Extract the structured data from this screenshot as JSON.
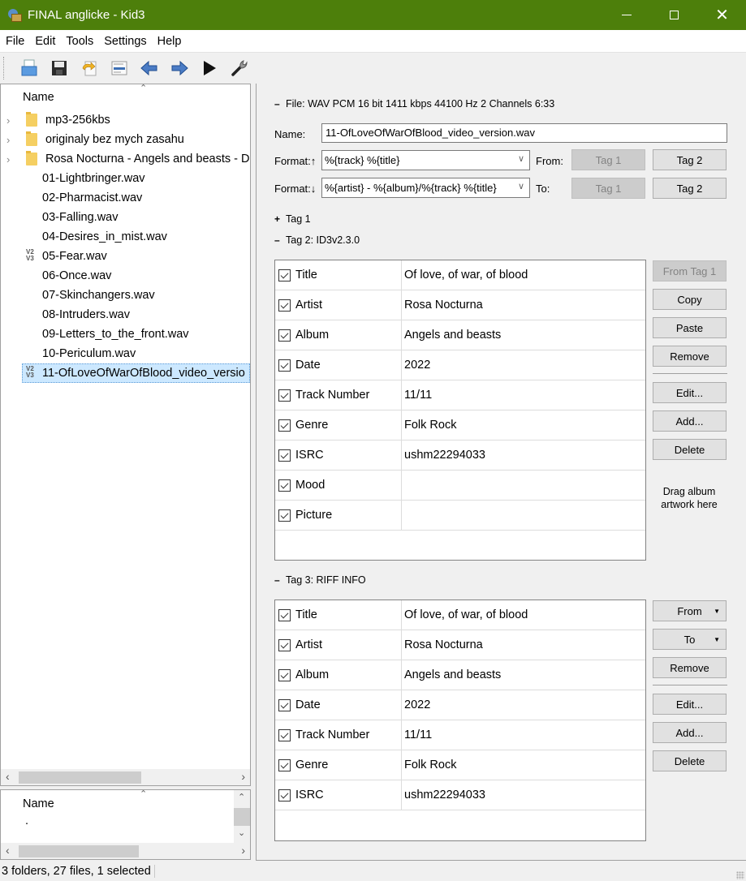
{
  "window": {
    "title": "FINAL anglicke - Kid3",
    "app_icon": "kid3-app-icon",
    "controls": [
      "minimize",
      "maximize",
      "close"
    ]
  },
  "menu": [
    "File",
    "Edit",
    "Tools",
    "Settings",
    "Help"
  ],
  "toolbar": [
    {
      "name": "open-directory",
      "icon": "folder-open-icon"
    },
    {
      "name": "save",
      "icon": "floppy-disk-icon"
    },
    {
      "name": "revert",
      "icon": "revert-icon"
    },
    {
      "name": "toggle-view",
      "icon": "document-view-icon"
    },
    {
      "name": "previous-file",
      "icon": "arrow-left-icon"
    },
    {
      "name": "next-file",
      "icon": "arrow-right-icon"
    },
    {
      "name": "play",
      "icon": "play-icon"
    },
    {
      "name": "settings",
      "icon": "wrench-icon"
    }
  ],
  "file_tree": {
    "header": "Name",
    "items": [
      {
        "type": "folder",
        "label": "mp3-256kbs"
      },
      {
        "type": "folder",
        "label": "originaly bez mych zasahu"
      },
      {
        "type": "folder",
        "label": "Rosa Nocturna - Angels and beasts - D"
      },
      {
        "type": "file",
        "label": "01-Lightbringer.wav",
        "badge": ""
      },
      {
        "type": "file",
        "label": "02-Pharmacist.wav",
        "badge": ""
      },
      {
        "type": "file",
        "label": "03-Falling.wav",
        "badge": ""
      },
      {
        "type": "file",
        "label": "04-Desires_in_mist.wav",
        "badge": ""
      },
      {
        "type": "file",
        "label": "05-Fear.wav",
        "badge": "V2 V3"
      },
      {
        "type": "file",
        "label": "06-Once.wav",
        "badge": ""
      },
      {
        "type": "file",
        "label": "07-Skinchangers.wav",
        "badge": ""
      },
      {
        "type": "file",
        "label": "08-Intruders.wav",
        "badge": ""
      },
      {
        "type": "file",
        "label": "09-Letters_to_the_front.wav",
        "badge": ""
      },
      {
        "type": "file",
        "label": "10-Periculum.wav",
        "badge": ""
      },
      {
        "type": "file",
        "label": "11-OfLoveOfWarOfBlood_video_versio",
        "badge": "V2 V3",
        "selected": true
      }
    ]
  },
  "dir_list": {
    "header": "Name",
    "items": [
      "."
    ]
  },
  "status": "3 folders, 27 files, 1 selected",
  "file_section": {
    "header": "File: WAV PCM 16 bit 1411 kbps 44100 Hz 2 Channels 6:33",
    "name_label": "Name:",
    "name_value": "11-OfLoveOfWarOfBlood_video_version.wav",
    "format_up_label": "Format:↑",
    "format_up_value": "%{track} %{title}",
    "format_down_label": "Format:↓",
    "format_down_value": "%{artist} - %{album}/%{track} %{title}",
    "from_label": "From:",
    "to_label": "To:",
    "tag1_button": "Tag 1",
    "tag2_button": "Tag 2"
  },
  "tag1": {
    "header": "Tag 1",
    "collapsed": true
  },
  "tag2": {
    "header": "Tag 2: ID3v2.3.0",
    "frames": [
      {
        "name": "Title",
        "value": "Of love, of war, of blood",
        "checked": true
      },
      {
        "name": "Artist",
        "value": "Rosa Nocturna",
        "checked": true
      },
      {
        "name": "Album",
        "value": "Angels and beasts",
        "checked": true
      },
      {
        "name": "Date",
        "value": "2022",
        "checked": true
      },
      {
        "name": "Track Number",
        "value": "11/11",
        "checked": true
      },
      {
        "name": "Genre",
        "value": "Folk Rock",
        "checked": true
      },
      {
        "name": "ISRC",
        "value": "ushm22294033",
        "checked": true
      },
      {
        "name": "Mood",
        "value": "",
        "checked": true
      },
      {
        "name": "Picture",
        "value": "",
        "checked": true
      }
    ],
    "buttons": {
      "from_tag1": "From Tag 1",
      "copy": "Copy",
      "paste": "Paste",
      "remove": "Remove",
      "edit": "Edit...",
      "add": "Add...",
      "delete": "Delete"
    },
    "drop_hint": "Drag album artwork here"
  },
  "tag3": {
    "header": "Tag 3: RIFF INFO",
    "frames": [
      {
        "name": "Title",
        "value": "Of love, of war, of blood",
        "checked": true
      },
      {
        "name": "Artist",
        "value": "Rosa Nocturna",
        "checked": true
      },
      {
        "name": "Album",
        "value": "Angels and beasts",
        "checked": true
      },
      {
        "name": "Date",
        "value": "2022",
        "checked": true
      },
      {
        "name": "Track Number",
        "value": "11/11",
        "checked": true
      },
      {
        "name": "Genre",
        "value": "Folk Rock",
        "checked": true
      },
      {
        "name": "ISRC",
        "value": "ushm22294033",
        "checked": true
      }
    ],
    "buttons": {
      "from": "From",
      "to": "To",
      "remove": "Remove",
      "edit": "Edit...",
      "add": "Add...",
      "delete": "Delete"
    }
  }
}
